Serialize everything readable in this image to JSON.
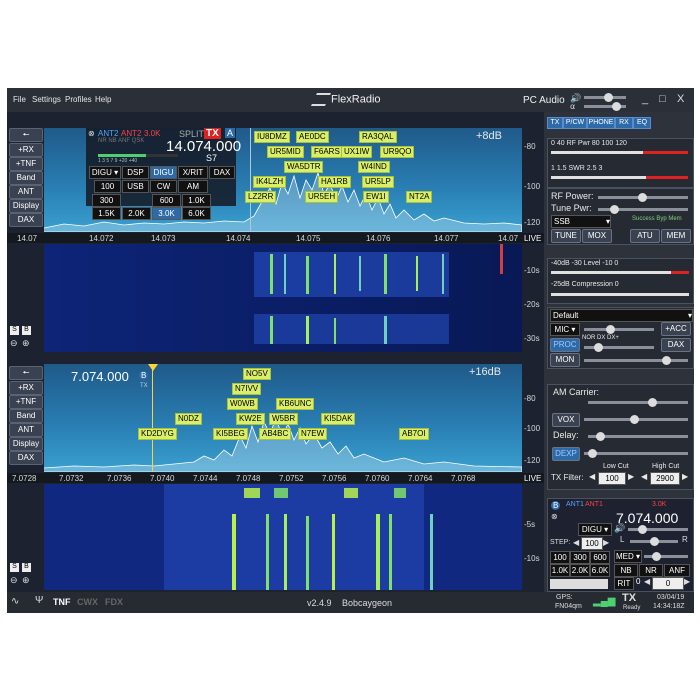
{
  "menu": [
    "File",
    "Settings",
    "Profiles",
    "Help"
  ],
  "app_title": "FlexRadio",
  "audio_label": "PC Audio",
  "window_buttons": [
    "_",
    "□",
    "X"
  ],
  "left_buttons_a": [
    "+RX",
    "+TNF",
    "Band",
    "ANT",
    "Display",
    "DAX"
  ],
  "left_buttons_b": [
    "+RX",
    "+TNF",
    "Band",
    "ANT",
    "Display",
    "DAX"
  ],
  "slice_a": {
    "ant1": "ANT2",
    "ant2": "ANT2",
    "bw": "3.0K",
    "flags": "NR NB ANF QSK",
    "split": "SPLIT",
    "tx": "TX",
    "letter": "A",
    "freq": "14.074.000",
    "smeter": "S7",
    "scale": "1  3  5  7  9  +20  +40",
    "tabs": [
      "DSP",
      "DIGU",
      "X/RIT",
      "DAX"
    ],
    "mode_select": "DIGU",
    "modes": [
      "USB",
      "CW",
      "AM"
    ],
    "filters": [
      "100",
      "300",
      "600",
      "1.0K",
      "1.5K",
      "2.0K",
      "3.0K",
      "6.0K"
    ]
  },
  "pan_a": {
    "gain": "+8dB",
    "db": [
      "-80",
      "-100",
      "-120"
    ],
    "db_wf": [
      "-10s",
      "-20s",
      "-30s"
    ],
    "freqs": [
      "14.07",
      "14.072",
      "14.073",
      "14.074",
      "14.075",
      "14.076",
      "14.077",
      "14.07"
    ],
    "live": "LIVE",
    "spots": [
      "IU8DMZ",
      "AE0DC",
      "RA3QAL",
      "UR5MID",
      "F6ARS",
      "UX1IW",
      "UR9QO",
      "WA5DTR",
      "W4IND",
      "IK4LZH",
      "HA1RB",
      "UR5LP",
      "LZ2RR",
      "UR5EH",
      "EW1I",
      "NT2A"
    ]
  },
  "pan_b": {
    "freq": "7.074.000",
    "letter": "B",
    "tx": "TX",
    "gain": "+16dB",
    "db": [
      "-80",
      "-100",
      "-120"
    ],
    "db_wf": [
      "-5s",
      "-10s"
    ],
    "freqs": [
      "7.0728",
      "7.0732",
      "7.0736",
      "7.0740",
      "7.0744",
      "7.0748",
      "7.0752",
      "7.0756",
      "7.0760",
      "7.0764",
      "7.0768"
    ],
    "live": "LIVE",
    "spots": [
      "NO5V",
      "N7IVV",
      "W0WB",
      "KB6UNC",
      "N0DZ",
      "KW2E",
      "W5BR",
      "KI5DAK",
      "KD2DYG",
      "KI5BEG",
      "AB4BC",
      "N7EW",
      "AB7OI"
    ]
  },
  "tx_tabs": [
    "TX",
    "P/CW",
    "PHONE",
    "RX",
    "EQ"
  ],
  "meter": {
    "scale1": "0   40   RF Pwr   80   100  120",
    "scale2": "1     1.5    SWR    2.5    3"
  },
  "tx_controls": {
    "rf_power": "RF Power:",
    "tune_pwr": "Tune Pwr:",
    "mode": "SSB",
    "tuner_flags": "Success Byp Mem",
    "buttons": [
      "TUNE",
      "MOX",
      "ATU",
      "MEM"
    ],
    "level_scale": "-40dB  -30    Level    -10     0",
    "comp_scale": "-25dB     Compression      0"
  },
  "phone": {
    "profile": "Default",
    "mic": "MIC",
    "acc": "+ACC",
    "proc_scale": "NOR      DX      DX+",
    "proc": "PROC",
    "dax": "DAX",
    "mon": "MON",
    "am_carrier": "AM Carrier:",
    "vox": "VOX",
    "delay": "Delay:",
    "dexp": "DEXP",
    "tx_filter": "TX Filter:",
    "low_cut": "Low Cut",
    "high_cut": "High Cut",
    "low_val": "100",
    "high_val": "2900"
  },
  "slice_b": {
    "letter": "B",
    "ant1": "ANT1",
    "ant2": "ANT1",
    "bw": "3.0K",
    "freq": "7.074.000",
    "mode": "DIGU",
    "step_label": "STEP:",
    "step": "100",
    "filters": [
      "100",
      "300",
      "600",
      "1.0K",
      "2.0K",
      "6.0K"
    ],
    "lr": [
      "L",
      "R"
    ],
    "agc": "MED",
    "dsp": [
      "NB",
      "NR",
      "ANF"
    ],
    "rit": "RIT",
    "rit_val": "0"
  },
  "status": {
    "modes": [
      "TNF",
      "CWX",
      "FDX"
    ],
    "version": "v2.4.9",
    "location": "Bobcaygeon",
    "gps": "GPS:",
    "grid": "FN04qm",
    "tx": "TX",
    "ready": "Ready",
    "date": "03/04/19",
    "time": "14:34:18Z"
  }
}
